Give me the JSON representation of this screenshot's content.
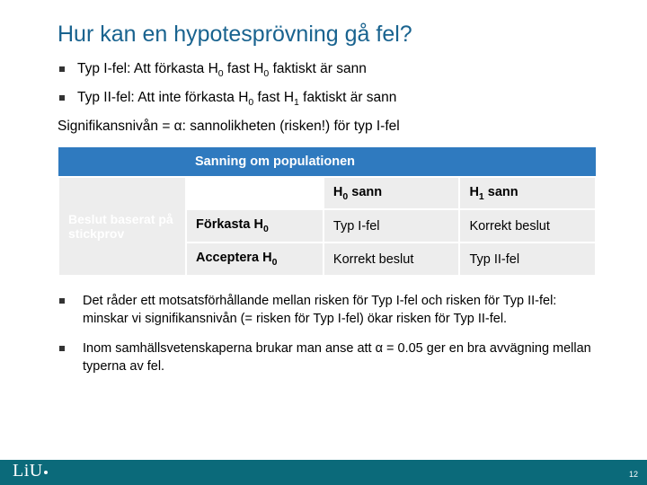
{
  "title": "Hur kan en hypotesprövning gå fel?",
  "bullets_top": [
    {
      "pre": "Typ I-fel: Att förkasta H",
      "sub1": "0",
      "mid": " fast H",
      "sub2": "0",
      "post": " faktiskt är sann"
    },
    {
      "pre": "Typ II-fel: Att inte förkasta H",
      "sub1": "0",
      "mid": " fast H",
      "sub2": "1",
      "post": " faktiskt är sann"
    }
  ],
  "sig_line": "Signifikansnivån = α: sannolikheten (risken!) för typ I-fel",
  "table": {
    "top_header": "Sanning om populationen",
    "left_header": "Beslut baserat på stickprov",
    "col_h0": {
      "pre": "H",
      "sub": "0",
      "post": " sann"
    },
    "col_h1": {
      "pre": "H",
      "sub": "1",
      "post": " sann"
    },
    "row1_label": {
      "pre": "Förkasta H",
      "sub": "0"
    },
    "row1_c1": "Typ I-fel",
    "row1_c2": "Korrekt beslut",
    "row2_label": {
      "pre": "Acceptera H",
      "sub": "0"
    },
    "row2_c1": "Korrekt beslut",
    "row2_c2": "Typ II-fel"
  },
  "bullets_bottom": [
    "Det råder ett motsatsförhållande mellan risken för Typ I-fel och risken för Typ II-fel: minskar vi signifikansnivån (= risken för Typ I-fel) ökar risken för Typ II-fel.",
    "Inom samhällsvetenskaperna brukar man anse att α = 0.05 ger en bra avvägning mellan typerna av fel."
  ],
  "logo_text": "LiU",
  "page_number": "12"
}
